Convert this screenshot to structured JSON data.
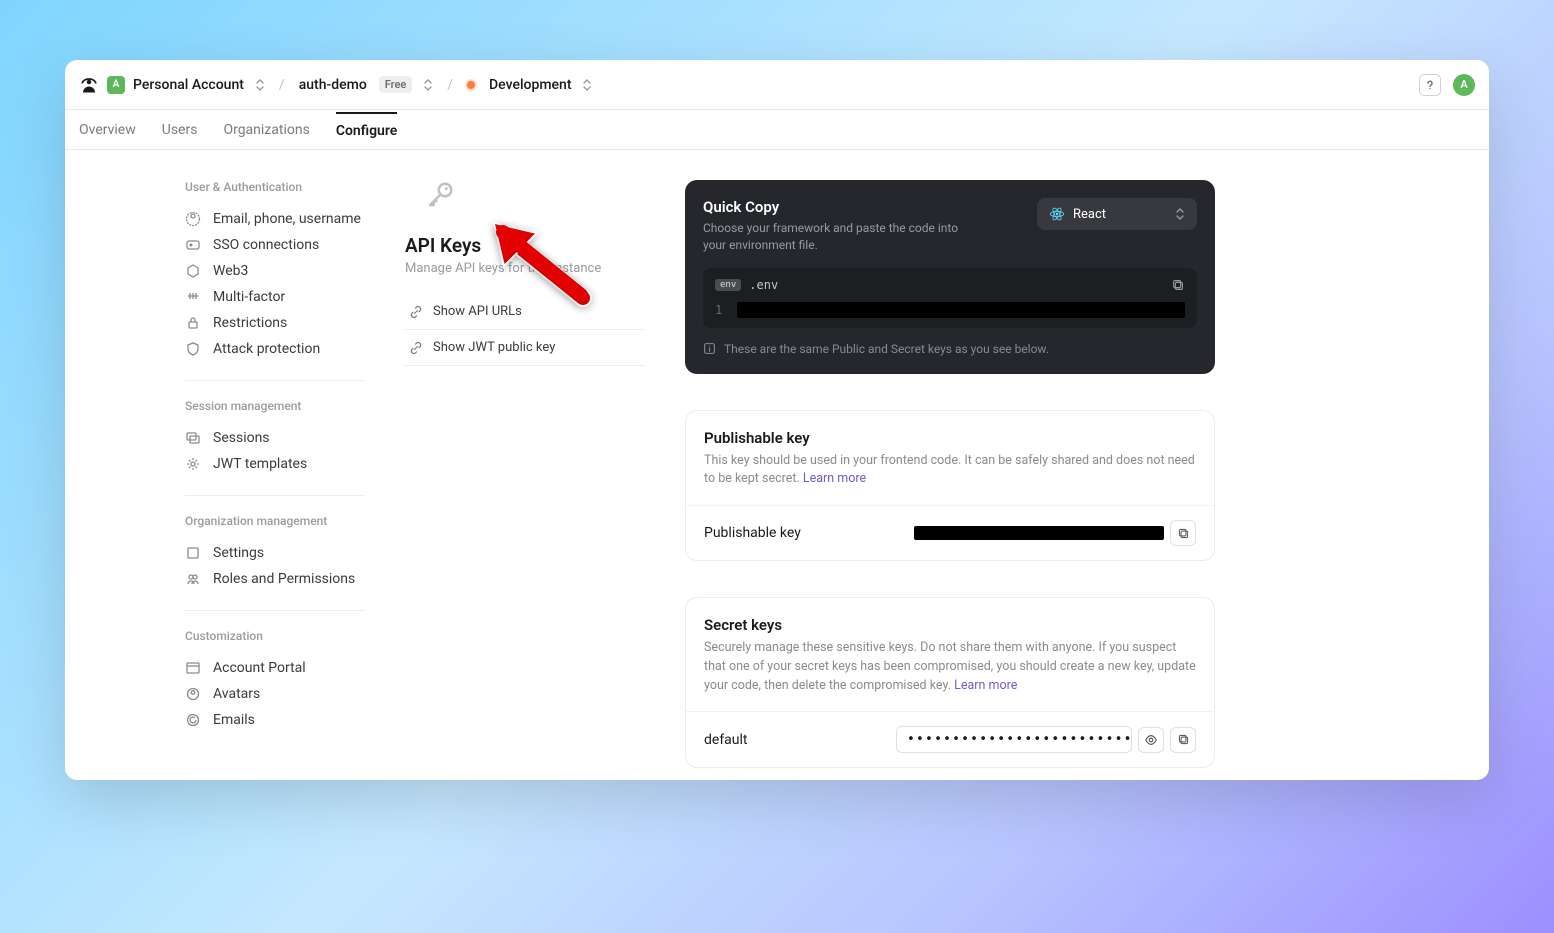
{
  "breadcrumb": {
    "account": "Personal Account",
    "project": "auth-demo",
    "project_badge": "Free",
    "environment": "Development"
  },
  "avatar_initial": "A",
  "tabs": [
    "Overview",
    "Users",
    "Organizations",
    "Configure"
  ],
  "active_tab": "Configure",
  "sidebar": {
    "sections": [
      {
        "heading": "User & Authentication",
        "items": [
          {
            "label": "Email, phone, username",
            "icon": "identity"
          },
          {
            "label": "SSO connections",
            "icon": "sso"
          },
          {
            "label": "Web3",
            "icon": "web3"
          },
          {
            "label": "Multi-factor",
            "icon": "mfa"
          },
          {
            "label": "Restrictions",
            "icon": "lock"
          },
          {
            "label": "Attack protection",
            "icon": "shield"
          }
        ]
      },
      {
        "heading": "Session management",
        "items": [
          {
            "label": "Sessions",
            "icon": "sessions"
          },
          {
            "label": "JWT templates",
            "icon": "gear"
          }
        ]
      },
      {
        "heading": "Organization management",
        "items": [
          {
            "label": "Settings",
            "icon": "settings"
          },
          {
            "label": "Roles and Permissions",
            "icon": "roles"
          }
        ]
      },
      {
        "heading": "Customization",
        "items": [
          {
            "label": "Account Portal",
            "icon": "portal"
          },
          {
            "label": "Avatars",
            "icon": "avatars"
          },
          {
            "label": "Emails",
            "icon": "emails"
          }
        ]
      }
    ]
  },
  "page": {
    "title": "API Keys",
    "subtitle": "Manage API keys for this instance",
    "actions": [
      {
        "label": "Show API URLs",
        "icon": "link"
      },
      {
        "label": "Show JWT public key",
        "icon": "link"
      }
    ]
  },
  "quick_copy": {
    "title": "Quick Copy",
    "subtitle": "Choose your framework and paste the code into your environment file.",
    "framework": "React",
    "filename": ".env",
    "line_no": "1",
    "footer": "These are the same Public and Secret keys as you see below."
  },
  "publishable": {
    "title": "Publishable key",
    "desc": "This key should be used in your frontend code. It can be safely shared and does not need to be kept secret. ",
    "learn_more": "Learn more",
    "row_label": "Publishable key"
  },
  "secret": {
    "title": "Secret keys",
    "desc": "Securely manage these sensitive keys. Do not share them with anyone. If you suspect that one of your secret keys has been compromised, you should create a new key, update your code, then delete the compromised key. ",
    "learn_more": "Learn more",
    "row_label": "default",
    "masked": "•••••••••••••••••••••••••••••••••••_"
  }
}
